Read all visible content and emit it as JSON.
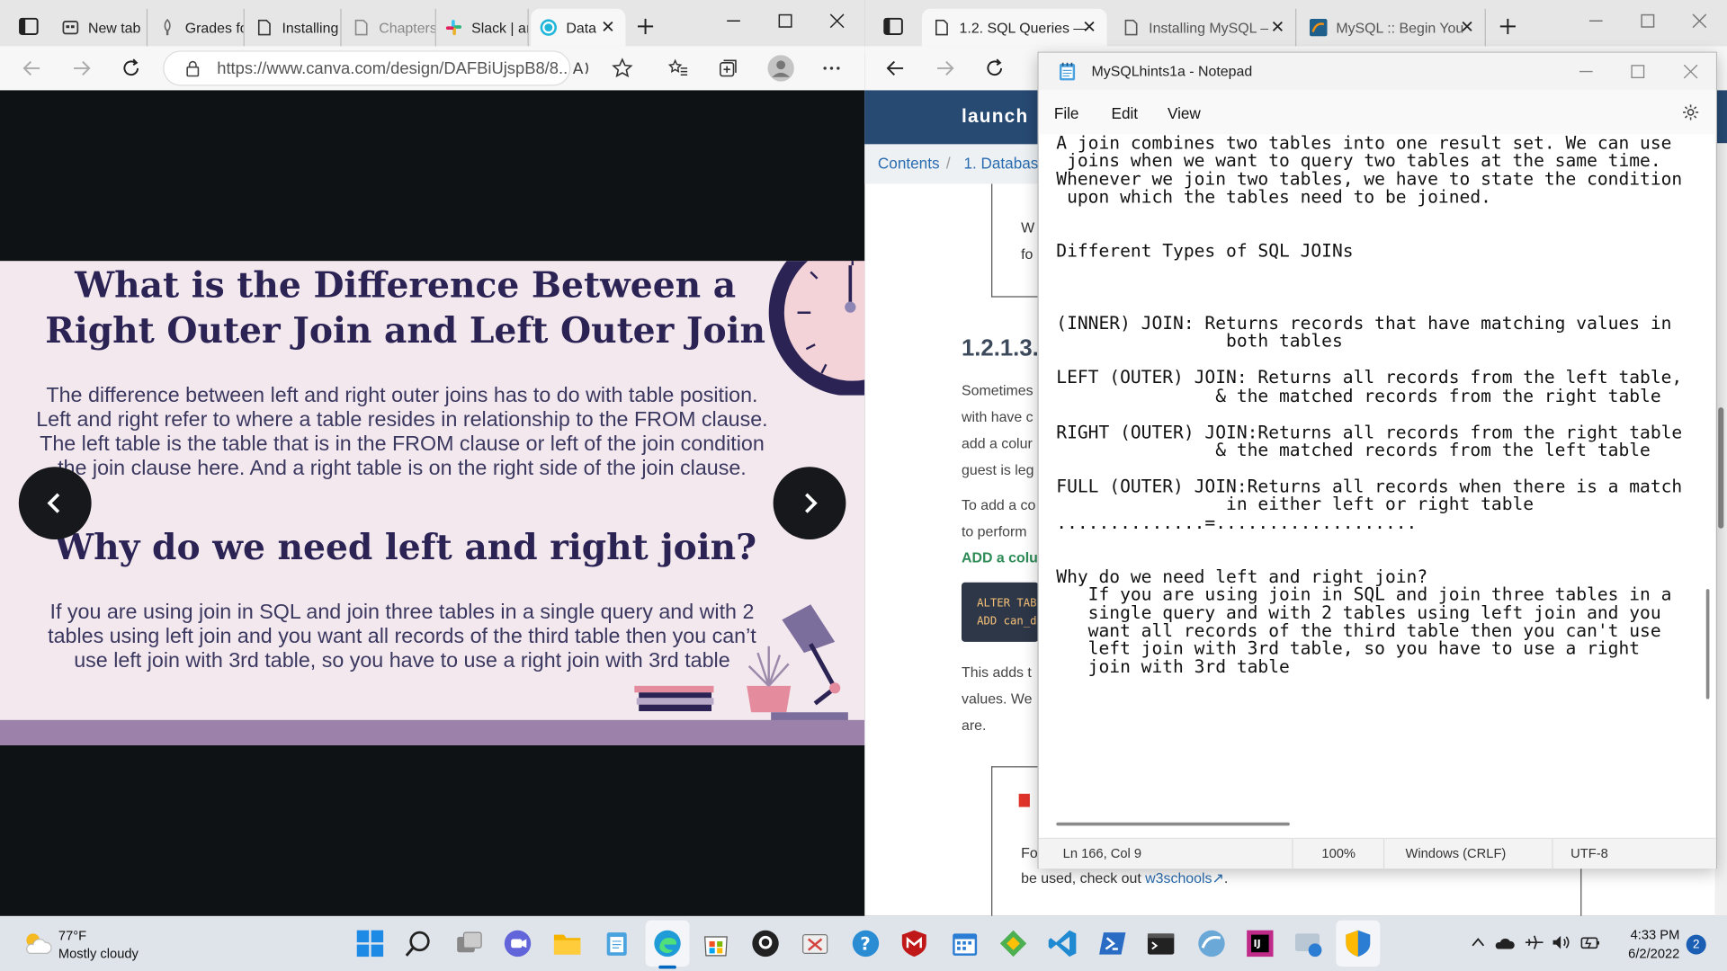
{
  "left_browser": {
    "tabs": [
      "New tab",
      "Grades fo",
      "Installing",
      "Chapters",
      "Slack | ar",
      "Data"
    ],
    "url": "https://www.canva.com/design/DAFBiUjspB8/8...",
    "slide": {
      "heading1": "What is the Difference Between a Right Outer Join and Left Outer Join",
      "para1": "The difference between left and right outer joins has to do with table position. Left and right refer to where a table resides in relationship to the FROM clause. The left table is the table that is in the FROM clause or left of the join condition the join clause here. And a right table is on the right side of the join clause.",
      "heading2": "Why do we need left and right join?",
      "para2": "If you are using join in SQL and join three tables in a single query and with 2 tables using left join and you want all records of the third table then you can’t use left join with 3rd table, so you have to use a right join with 3rd table"
    }
  },
  "right_browser": {
    "tabs": [
      "1.2. SQL Queries —",
      "Installing MySQL –",
      "MySQL :: Begin You"
    ],
    "brand": "launch",
    "breadcrumb": [
      "Contents",
      "1. Databas"
    ],
    "section": "1.2.1.3.",
    "body_lines": [
      "Sometimes",
      "with have c",
      "add a colur",
      "guest is leg",
      "To add a co",
      "to perform",
      "ADD a colum",
      "This adds t",
      "values. We",
      "are."
    ],
    "code": [
      "ALTER TAB",
      "ADD can_d"
    ],
    "footer_prefix": "Fo",
    "footer_text": "be used, check out ",
    "footer_link": "w3schools"
  },
  "notepad": {
    "title": "MySQLhints1a - Notepad",
    "menu": [
      "File",
      "Edit",
      "View"
    ],
    "content": "A join combines two tables into one result set. We can use\n joins when we want to query two tables at the same time.\nWhenever we join two tables, we have to state the condition\n upon which the tables need to be joined.\n\n\nDifferent Types of SQL JOINs\n\n\n\n(INNER) JOIN: Returns records that have matching values in\n                both tables\n\nLEFT (OUTER) JOIN: Returns all records from the left table,\n               & the matched records from the right table\n\nRIGHT (OUTER) JOIN:Returns all records from the right table\n               & the matched records from the left table\n\nFULL (OUTER) JOIN:Returns all records when there is a match\n                in either left or right table\n..............=...................\n\n\nWhy do we need left and right join?\n   If you are using join in SQL and join three tables in a\n   single query and with 2 tables using left join and you\n   want all records of the third table then you can't use\n   left join with 3rd table, so you have to use a right\n   join with 3rd table",
    "status": {
      "position": "Ln 166, Col 9",
      "zoom": "100%",
      "eol": "Windows (CRLF)",
      "encoding": "UTF-8"
    }
  },
  "taskbar": {
    "weather_temp": "77°F",
    "weather_desc": "Mostly cloudy",
    "time": "4:33 PM",
    "date": "6/2/2022",
    "notifications": "2"
  }
}
